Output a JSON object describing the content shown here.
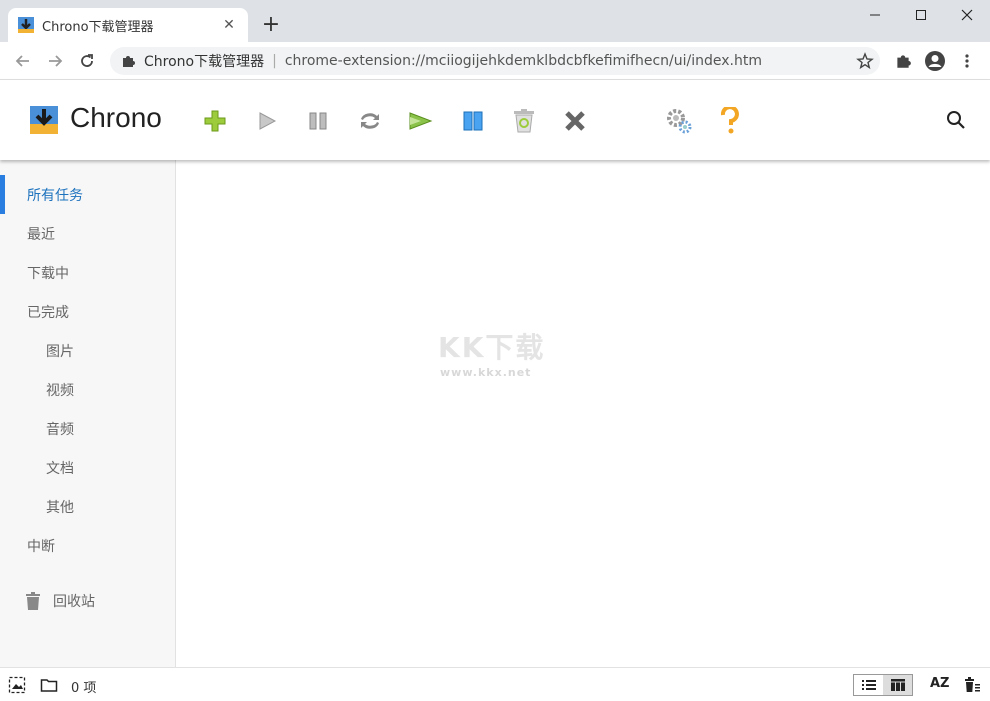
{
  "browser": {
    "tab_title": "Chrono下载管理器",
    "tab_close": "✕",
    "new_tab": "+",
    "omnibox_site": "Chrono下载管理器",
    "omnibox_sep": "|",
    "omnibox_url": "chrome-extension://mciiogijehkdemklbdcbfkefimifhecn/ui/index.htm"
  },
  "app": {
    "brand": "Chrono",
    "toolbar_icons": [
      "add-icon",
      "play-icon",
      "pause-icon",
      "refresh-icon",
      "start-all-icon",
      "pause-all-icon",
      "recycle-icon",
      "delete-icon",
      "settings-icon",
      "help-icon"
    ]
  },
  "sidebar": {
    "items": [
      {
        "label": "所有任务"
      },
      {
        "label": "最近"
      },
      {
        "label": "下载中"
      },
      {
        "label": "已完成"
      },
      {
        "label": "图片"
      },
      {
        "label": "视频"
      },
      {
        "label": "音频"
      },
      {
        "label": "文档"
      },
      {
        "label": "其他"
      },
      {
        "label": "中断"
      },
      {
        "label": "回收站"
      }
    ]
  },
  "watermark": {
    "main": "KK下载",
    "sub": "www.kkx.net"
  },
  "status": {
    "count": "0 项",
    "sort": "AZ"
  },
  "colors": {
    "accent": "#1e73be",
    "sidebar_bg": "#f7f7f7",
    "tabstrip_bg": "#dee1e6"
  }
}
